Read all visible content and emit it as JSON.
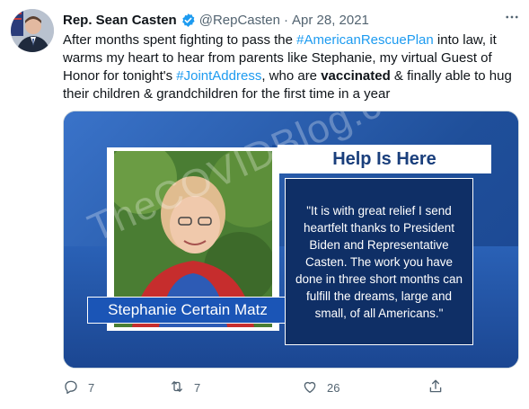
{
  "author": {
    "name": "Rep. Sean Casten",
    "handle": "@RepCasten",
    "separator": "·",
    "date": "Apr 28, 2021"
  },
  "tweet": {
    "t1": "After months spent fighting to pass the ",
    "hashtag1": "#AmericanRescuePlan",
    "t2": " into law, it warms my heart to hear from parents like Stephanie, my virtual Guest of Honor for tonight's ",
    "hashtag2": "#JointAddress",
    "t3": ", who are ",
    "bold": "vaccinated",
    "t4": " & finally able to hug their children & grandchildren for the first time in a year"
  },
  "media": {
    "header": "Help Is Here",
    "quote": "\"It is with great relief I send heartfelt thanks to President Biden and Representative Casten. The work you have done in three short months can fulfill the dreams, large and small, of all Americans.\"",
    "name_caption": "Stephanie Certain Matz",
    "watermark": "TheCOVIDBlog.com"
  },
  "actions": {
    "replies": "7",
    "retweets": "7",
    "likes": "26"
  },
  "colors": {
    "link": "#1d9bf0",
    "verified": "#1d9bf0",
    "muted": "#536471",
    "graphic_navy": "#0f2f66",
    "graphic_blue": "#1b55b6"
  },
  "icons": [
    "more-icon",
    "verified-icon",
    "reply-icon",
    "retweet-icon",
    "like-icon",
    "share-icon"
  ]
}
